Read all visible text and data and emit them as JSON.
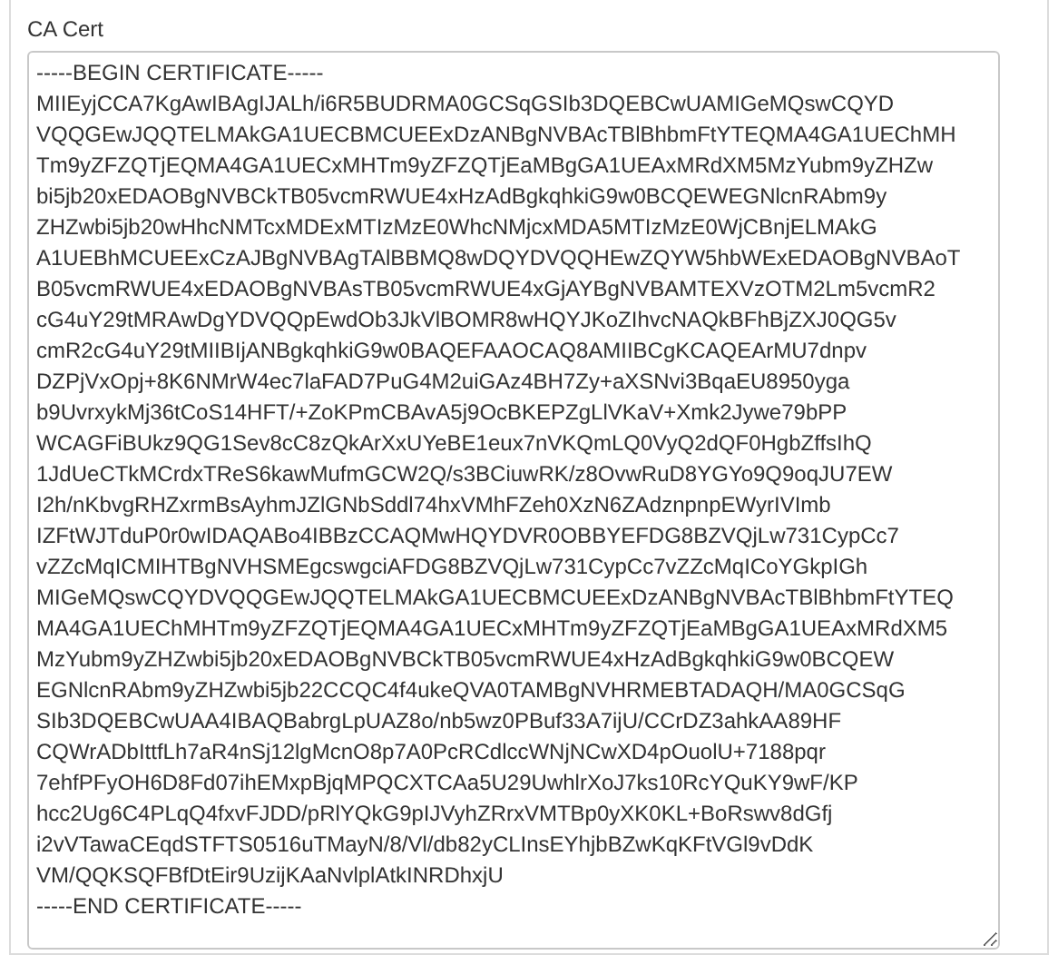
{
  "field": {
    "label": "CA Cert",
    "value": "-----BEGIN CERTIFICATE-----\nMIIEyjCCA7KgAwIBAgIJALh/i6R5BUDRMA0GCSqGSIb3DQEBCwUAMIGeMQswCQYD\nVQQGEwJQQTELMAkGA1UECBMCUEExDzANBgNVBAcTBlBhbmFtYTEQMA4GA1UEChMH\nTm9yZFZQTjEQMA4GA1UECxMHTm9yZFZQTjEaMBgGA1UEAxMRdXM5MzYubm9yZHZw\nbi5jb20xEDAOBgNVBCkTB05vcmRWUE4xHzAdBgkqhkiG9w0BCQEWEGNlcnRAbm9y\nZHZwbi5jb20wHhcNMTcxMDExMTIzMzE0WhcNMjcxMDA5MTIzMzE0WjCBnjELMAkG\nA1UEBhMCUEExCzAJBgNVBAgTAlBBMQ8wDQYDVQQHEwZQYW5hbWExEDAOBgNVBAoT\nB05vcmRWUE4xEDAOBgNVBAsTB05vcmRWUE4xGjAYBgNVBAMTEXVzOTM2Lm5vcmR2\ncG4uY29tMRAwDgYDVQQpEwdOb3JkVlBOMR8wHQYJKoZIhvcNAQkBFhBjZXJ0QG5v\ncmR2cG4uY29tMIIBIjANBgkqhkiG9w0BAQEFAAOCAQ8AMIIBCgKCAQEArMU7dnpv\nDZPjVxOpj+8K6NMrW4ec7laFAD7PuG4M2uiGAz4BH7Zy+aXSNvi3BqaEU8950yga\nb9UvrxykMj36tCoS14HFT/+ZoKPmCBAvA5j9OcBKEPZgLlVKaV+Xmk2Jywe79bPP\nWCAGFiBUkz9QG1Sev8cC8zQkArXxUYeBE1eux7nVKQmLQ0VyQ2dQF0HgbZffsIhQ\n1JdUeCTkMCrdxTReS6kawMufmGCW2Q/s3BCiuwRK/z8OvwRuD8YGYo9Q9oqJU7EW\nI2h/nKbvgRHZxrmBsAyhmJZlGNbSddl74hxVMhFZeh0XzN6ZAdznpnpEWyrIVImb\nIZFtWJTduP0r0wIDAQABo4IBBzCCAQMwHQYDVR0OBBYEFDG8BZVQjLw731CypCc7\nvZZcMqICMIHTBgNVHSMEgcswgciAFDG8BZVQjLw731CypCc7vZZcMqICoYGkpIGh\nMIGeMQswCQYDVQQGEwJQQTELMAkGA1UECBMCUEExDzANBgNVBAcTBlBhbmFtYTEQ\nMA4GA1UEChMHTm9yZFZQTjEQMA4GA1UECxMHTm9yZFZQTjEaMBgGA1UEAxMRdXM5\nMzYubm9yZHZwbi5jb20xEDAOBgNVBCkTB05vcmRWUE4xHzAdBgkqhkiG9w0BCQEW\nEGNlcnRAbm9yZHZwbi5jb22CCQC4f4ukeQVA0TAMBgNVHRMEBTADAQH/MA0GCSqG\nSIb3DQEBCwUAA4IBAQBabrgLpUAZ8o/nb5wz0PBuf33A7ijU/CCrDZ3ahkAA89HF\nCQWrADbIttfLh7aR4nSj12lgMcnO8p7A0PcRCdlccWNjNCwXD4pOuolU+7188pqr\n7ehfPFyOH6D8Fd07ihEMxpBjqMPQCXTCAa5U29UwhlrXoJ7ks10RcYQuKY9wF/KP\nhcc2Ug6C4PLqQ4fxvFJDD/pRlYQkG9pIJVyhZRrxVMTBp0yXK0KL+BoRswv8dGfj\ni2vVTawaCEqdSTFTS0516uTMayN/8/Vl/db82yCLInsEYhjbBZwKqKFtVGl9vDdK\nVM/QQKSQFBfDtEir9UzijKAaNvlplAtkINRDhxjU\n-----END CERTIFICATE-----"
  }
}
